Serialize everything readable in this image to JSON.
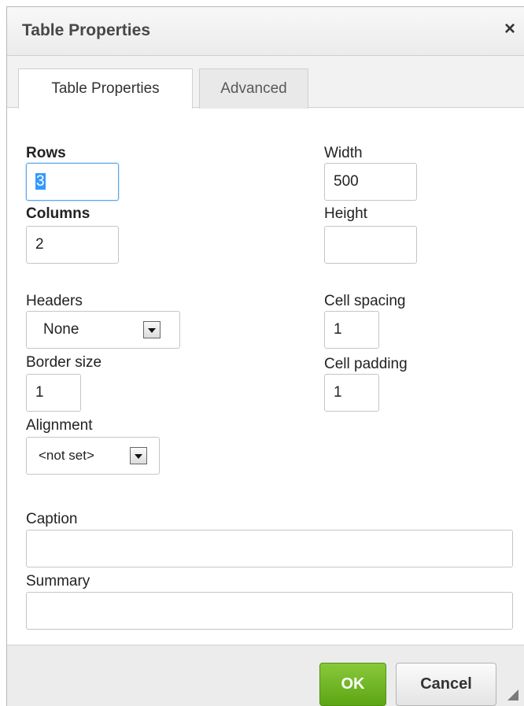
{
  "dialog": {
    "title": "Table Properties",
    "close_glyph": "×"
  },
  "tabs": [
    {
      "label": "Table Properties",
      "active": true
    },
    {
      "label": "Advanced",
      "active": false
    }
  ],
  "form": {
    "rows": {
      "label": "Rows",
      "value": "3"
    },
    "columns": {
      "label": "Columns",
      "value": "2"
    },
    "width": {
      "label": "Width",
      "value": "500"
    },
    "height": {
      "label": "Height",
      "value": ""
    },
    "headers": {
      "label": "Headers",
      "value": "None"
    },
    "cell_spacing": {
      "label": "Cell spacing",
      "value": "1"
    },
    "border_size": {
      "label": "Border size",
      "value": "1"
    },
    "cell_padding": {
      "label": "Cell padding",
      "value": "1"
    },
    "alignment": {
      "label": "Alignment",
      "value": "<not set>"
    },
    "caption": {
      "label": "Caption",
      "value": ""
    },
    "summary": {
      "label": "Summary",
      "value": ""
    }
  },
  "footer": {
    "ok_label": "OK",
    "cancel_label": "Cancel"
  },
  "colors": {
    "ok_button": "#6fb827",
    "focus_border": "#59a5ea",
    "selection": "#3399ff"
  },
  "icons": {
    "close": "close-icon",
    "dropdown": "chevron-down-icon",
    "resize": "resize-grip-icon"
  }
}
